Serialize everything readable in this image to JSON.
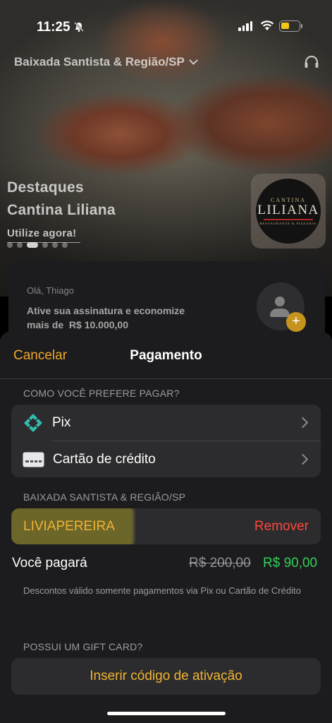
{
  "status_bar": {
    "time": "11:25",
    "battery_level": 0.3,
    "battery_color": "#f5c518"
  },
  "header": {
    "region": "Baixada Santista & Região/SP",
    "region_icon": "chevron-down-icon",
    "support_icon": "headset-icon"
  },
  "featured": {
    "title_line1": "Destaques",
    "title_line2": "Cantina Liliana",
    "cta": "Utilize agora!",
    "carousel_pages": 6,
    "carousel_active": 2,
    "logo": {
      "top_text": "CANTINA",
      "name": "LILIANA",
      "tagline": "RESTAURANTE & PIZZARIA"
    }
  },
  "subscription_card": {
    "greeting": "Olá, Thiago",
    "message_line1": "Ative sua assinatura e economize",
    "message_line2": "mais de  R$ 10.000,00",
    "add_icon": "plus-icon"
  },
  "payment_sheet": {
    "cancel_label": "Cancelar",
    "title": "Pagamento",
    "payment_section_label": "COMO VOCÊ PREFERE PAGAR?",
    "methods": [
      {
        "label": "Pix",
        "icon": "pix-icon"
      },
      {
        "label": "Cartão de crédito",
        "icon": "credit-card-icon"
      }
    ],
    "region_section_label": "BAIXADA SANTISTA & REGIÃO/SP",
    "coupon_code": "LIVIAPEREIRA",
    "remove_label": "Remover",
    "pay_label": "Você pagará",
    "old_price": "R$ 200,00",
    "new_price": "R$ 90,00",
    "discount_note": "Descontos válido somente pagamentos via Pix ou Cartão de Crédito",
    "gift_section_label": "POSSUI UM GIFT CARD?",
    "gift_button_label": "Inserir código de ativação"
  },
  "colors": {
    "accent": "#f0a82a",
    "danger": "#ff453a",
    "success": "#30d158",
    "pix": "#32bcad",
    "sheet_bg": "#1c1c1e",
    "group_bg": "#2c2c2e"
  }
}
